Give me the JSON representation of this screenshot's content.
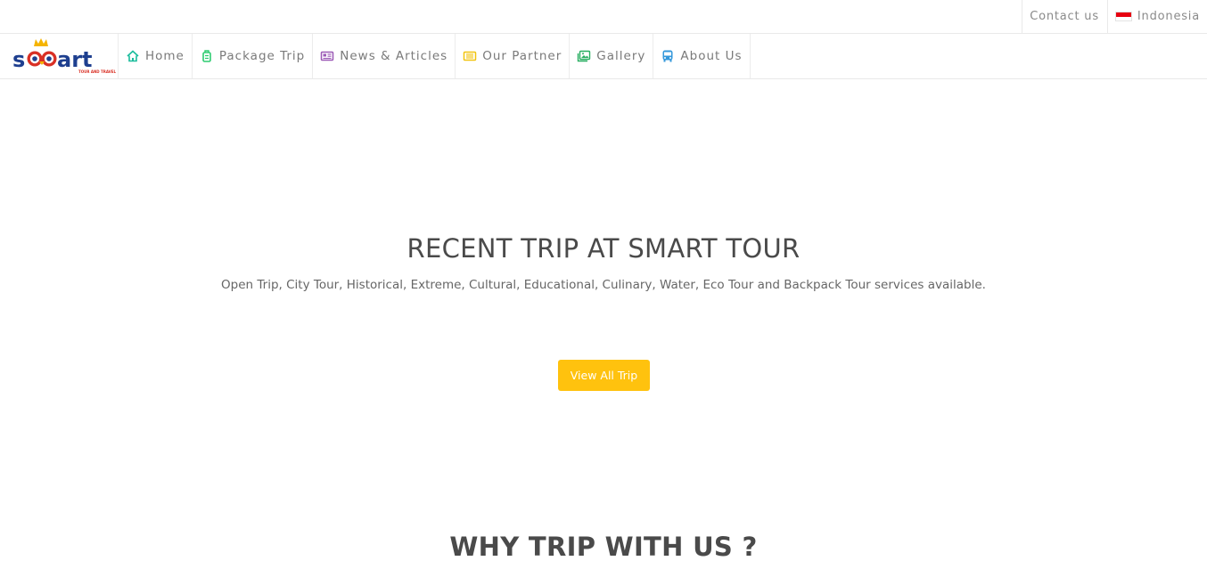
{
  "topbar": {
    "contact_label": "Contact us",
    "language_label": "Indonesia"
  },
  "brand": {
    "logo_text": "smart",
    "logo_tagline": "TOUR AND TRAVEL"
  },
  "nav": {
    "items": [
      {
        "label": "Home",
        "icon": "home-icon",
        "color": "#1abc9c"
      },
      {
        "label": "Package Trip",
        "icon": "luggage-icon",
        "color": "#2ecc71"
      },
      {
        "label": "News & Articles",
        "icon": "newspaper-icon",
        "color": "#9b59b6"
      },
      {
        "label": "Our Partner",
        "icon": "id-card-icon",
        "color": "#f1c40f"
      },
      {
        "label": "Gallery",
        "icon": "images-icon",
        "color": "#27ae60"
      },
      {
        "label": "About Us",
        "icon": "bus-icon",
        "color": "#3498db"
      }
    ]
  },
  "hero": {
    "title": "RECENT TRIP AT SMART TOUR",
    "subtitle": "Open Trip, City Tour, Historical, Extreme, Cultural, Educational, Culinary, Water, Eco Tour and Backpack Tour services available.",
    "button_label": "View All Trip"
  },
  "why": {
    "title": "WHY TRIP WITH US ?"
  },
  "colors": {
    "accent": "#ffc20e",
    "logo_blue": "#1e3f8f",
    "logo_red": "#d93025",
    "logo_yellow": "#f5b400"
  }
}
